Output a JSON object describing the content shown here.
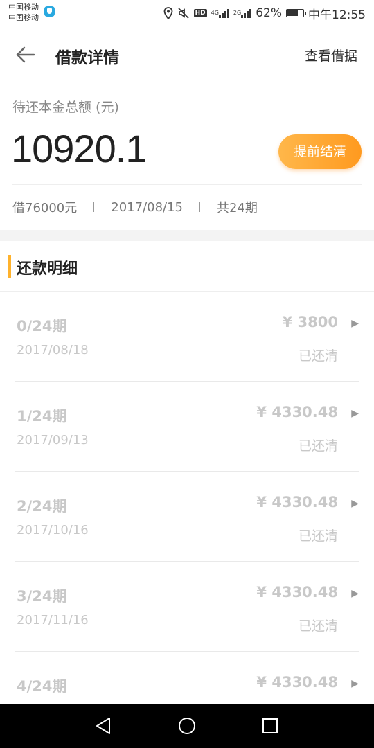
{
  "status_bar": {
    "carrier_1": "中国移动",
    "carrier_2": "中国移动",
    "network_1": "4G",
    "network_2": "2G",
    "hd": "HD",
    "battery": "62%",
    "time": "中午12:55"
  },
  "header": {
    "title": "借款详情",
    "view_receipt": "查看借据"
  },
  "summary": {
    "label": "待还本金总额 (元)",
    "amount": "10920.1",
    "settle_button": "提前结清",
    "loan_amount": "借76000元",
    "loan_date": "2017/08/15",
    "total_periods": "共24期"
  },
  "detail": {
    "title": "还款明细",
    "rows": [
      {
        "period": "0/24期",
        "date": "2017/08/18",
        "amount": "¥ 3800",
        "status": "已还清"
      },
      {
        "period": "1/24期",
        "date": "2017/09/13",
        "amount": "¥ 4330.48",
        "status": "已还清"
      },
      {
        "period": "2/24期",
        "date": "2017/10/16",
        "amount": "¥ 4330.48",
        "status": "已还清"
      },
      {
        "period": "3/24期",
        "date": "2017/11/16",
        "amount": "¥ 4330.48",
        "status": "已还清"
      },
      {
        "period": "4/24期",
        "date": "",
        "amount": "¥ 4330.48",
        "status": ""
      }
    ]
  },
  "colors": {
    "accent": "#ffb22c",
    "button_start": "#ffb74a",
    "button_end": "#ff9a1f",
    "muted_text": "#c8c8c8"
  },
  "icons": {
    "back": "arrow-left-icon",
    "row_chevron": "chevron-right-icon",
    "nav_back": "triangle-back-icon",
    "nav_home": "circle-home-icon",
    "nav_recent": "square-recent-icon"
  }
}
